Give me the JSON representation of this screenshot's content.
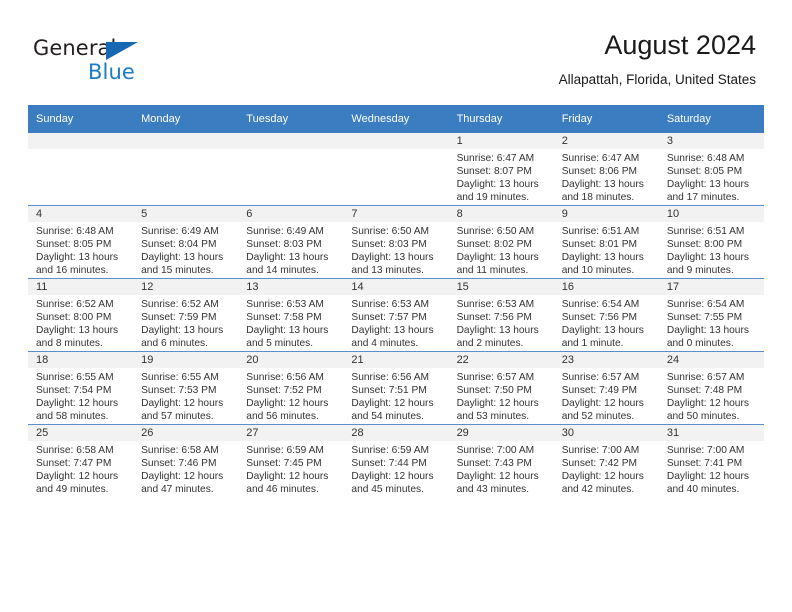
{
  "brand": {
    "name_top": "General",
    "name_bottom": "Blue",
    "triangle_color": "#1668b3",
    "blue_color": "#1c7cc4"
  },
  "header": {
    "title": "August 2024",
    "subtitle": "Allapattah, Florida, United States"
  },
  "theme": {
    "header_blue": "#3b7dc0",
    "row_divider": "#5b8fc9",
    "date_band": "#f2f2f2"
  },
  "weekdays": [
    "Sunday",
    "Monday",
    "Tuesday",
    "Wednesday",
    "Thursday",
    "Friday",
    "Saturday"
  ],
  "weeks": [
    [
      {
        "empty": true
      },
      {
        "empty": true
      },
      {
        "empty": true
      },
      {
        "empty": true
      },
      {
        "date": "1",
        "sunrise": "Sunrise: 6:47 AM",
        "sunset": "Sunset: 8:07 PM",
        "daylight1": "Daylight: 13 hours",
        "daylight2": "and 19 minutes."
      },
      {
        "date": "2",
        "sunrise": "Sunrise: 6:47 AM",
        "sunset": "Sunset: 8:06 PM",
        "daylight1": "Daylight: 13 hours",
        "daylight2": "and 18 minutes."
      },
      {
        "date": "3",
        "sunrise": "Sunrise: 6:48 AM",
        "sunset": "Sunset: 8:05 PM",
        "daylight1": "Daylight: 13 hours",
        "daylight2": "and 17 minutes."
      }
    ],
    [
      {
        "date": "4",
        "sunrise": "Sunrise: 6:48 AM",
        "sunset": "Sunset: 8:05 PM",
        "daylight1": "Daylight: 13 hours",
        "daylight2": "and 16 minutes."
      },
      {
        "date": "5",
        "sunrise": "Sunrise: 6:49 AM",
        "sunset": "Sunset: 8:04 PM",
        "daylight1": "Daylight: 13 hours",
        "daylight2": "and 15 minutes."
      },
      {
        "date": "6",
        "sunrise": "Sunrise: 6:49 AM",
        "sunset": "Sunset: 8:03 PM",
        "daylight1": "Daylight: 13 hours",
        "daylight2": "and 14 minutes."
      },
      {
        "date": "7",
        "sunrise": "Sunrise: 6:50 AM",
        "sunset": "Sunset: 8:03 PM",
        "daylight1": "Daylight: 13 hours",
        "daylight2": "and 13 minutes."
      },
      {
        "date": "8",
        "sunrise": "Sunrise: 6:50 AM",
        "sunset": "Sunset: 8:02 PM",
        "daylight1": "Daylight: 13 hours",
        "daylight2": "and 11 minutes."
      },
      {
        "date": "9",
        "sunrise": "Sunrise: 6:51 AM",
        "sunset": "Sunset: 8:01 PM",
        "daylight1": "Daylight: 13 hours",
        "daylight2": "and 10 minutes."
      },
      {
        "date": "10",
        "sunrise": "Sunrise: 6:51 AM",
        "sunset": "Sunset: 8:00 PM",
        "daylight1": "Daylight: 13 hours",
        "daylight2": "and 9 minutes."
      }
    ],
    [
      {
        "date": "11",
        "sunrise": "Sunrise: 6:52 AM",
        "sunset": "Sunset: 8:00 PM",
        "daylight1": "Daylight: 13 hours",
        "daylight2": "and 8 minutes."
      },
      {
        "date": "12",
        "sunrise": "Sunrise: 6:52 AM",
        "sunset": "Sunset: 7:59 PM",
        "daylight1": "Daylight: 13 hours",
        "daylight2": "and 6 minutes."
      },
      {
        "date": "13",
        "sunrise": "Sunrise: 6:53 AM",
        "sunset": "Sunset: 7:58 PM",
        "daylight1": "Daylight: 13 hours",
        "daylight2": "and 5 minutes."
      },
      {
        "date": "14",
        "sunrise": "Sunrise: 6:53 AM",
        "sunset": "Sunset: 7:57 PM",
        "daylight1": "Daylight: 13 hours",
        "daylight2": "and 4 minutes."
      },
      {
        "date": "15",
        "sunrise": "Sunrise: 6:53 AM",
        "sunset": "Sunset: 7:56 PM",
        "daylight1": "Daylight: 13 hours",
        "daylight2": "and 2 minutes."
      },
      {
        "date": "16",
        "sunrise": "Sunrise: 6:54 AM",
        "sunset": "Sunset: 7:56 PM",
        "daylight1": "Daylight: 13 hours",
        "daylight2": "and 1 minute."
      },
      {
        "date": "17",
        "sunrise": "Sunrise: 6:54 AM",
        "sunset": "Sunset: 7:55 PM",
        "daylight1": "Daylight: 13 hours",
        "daylight2": "and 0 minutes."
      }
    ],
    [
      {
        "date": "18",
        "sunrise": "Sunrise: 6:55 AM",
        "sunset": "Sunset: 7:54 PM",
        "daylight1": "Daylight: 12 hours",
        "daylight2": "and 58 minutes."
      },
      {
        "date": "19",
        "sunrise": "Sunrise: 6:55 AM",
        "sunset": "Sunset: 7:53 PM",
        "daylight1": "Daylight: 12 hours",
        "daylight2": "and 57 minutes."
      },
      {
        "date": "20",
        "sunrise": "Sunrise: 6:56 AM",
        "sunset": "Sunset: 7:52 PM",
        "daylight1": "Daylight: 12 hours",
        "daylight2": "and 56 minutes."
      },
      {
        "date": "21",
        "sunrise": "Sunrise: 6:56 AM",
        "sunset": "Sunset: 7:51 PM",
        "daylight1": "Daylight: 12 hours",
        "daylight2": "and 54 minutes."
      },
      {
        "date": "22",
        "sunrise": "Sunrise: 6:57 AM",
        "sunset": "Sunset: 7:50 PM",
        "daylight1": "Daylight: 12 hours",
        "daylight2": "and 53 minutes."
      },
      {
        "date": "23",
        "sunrise": "Sunrise: 6:57 AM",
        "sunset": "Sunset: 7:49 PM",
        "daylight1": "Daylight: 12 hours",
        "daylight2": "and 52 minutes."
      },
      {
        "date": "24",
        "sunrise": "Sunrise: 6:57 AM",
        "sunset": "Sunset: 7:48 PM",
        "daylight1": "Daylight: 12 hours",
        "daylight2": "and 50 minutes."
      }
    ],
    [
      {
        "date": "25",
        "sunrise": "Sunrise: 6:58 AM",
        "sunset": "Sunset: 7:47 PM",
        "daylight1": "Daylight: 12 hours",
        "daylight2": "and 49 minutes."
      },
      {
        "date": "26",
        "sunrise": "Sunrise: 6:58 AM",
        "sunset": "Sunset: 7:46 PM",
        "daylight1": "Daylight: 12 hours",
        "daylight2": "and 47 minutes."
      },
      {
        "date": "27",
        "sunrise": "Sunrise: 6:59 AM",
        "sunset": "Sunset: 7:45 PM",
        "daylight1": "Daylight: 12 hours",
        "daylight2": "and 46 minutes."
      },
      {
        "date": "28",
        "sunrise": "Sunrise: 6:59 AM",
        "sunset": "Sunset: 7:44 PM",
        "daylight1": "Daylight: 12 hours",
        "daylight2": "and 45 minutes."
      },
      {
        "date": "29",
        "sunrise": "Sunrise: 7:00 AM",
        "sunset": "Sunset: 7:43 PM",
        "daylight1": "Daylight: 12 hours",
        "daylight2": "and 43 minutes."
      },
      {
        "date": "30",
        "sunrise": "Sunrise: 7:00 AM",
        "sunset": "Sunset: 7:42 PM",
        "daylight1": "Daylight: 12 hours",
        "daylight2": "and 42 minutes."
      },
      {
        "date": "31",
        "sunrise": "Sunrise: 7:00 AM",
        "sunset": "Sunset: 7:41 PM",
        "daylight1": "Daylight: 12 hours",
        "daylight2": "and 40 minutes."
      }
    ]
  ]
}
